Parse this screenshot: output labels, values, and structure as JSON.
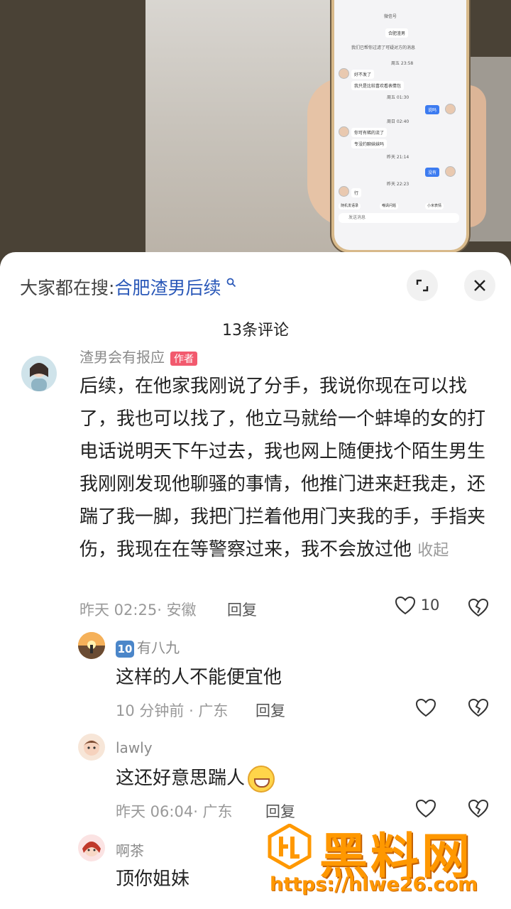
{
  "video": {
    "phone_chat": {
      "title": "微信号",
      "label_chip": "合肥渣男",
      "notice": "我们已帮你过滤了可疑对方的消息",
      "time1": "周五 23:58",
      "msg1": "好不发了",
      "msg2": "我只是比较喜欢看表情包",
      "time2": "周五 01:30",
      "my_msg1": "说吗",
      "time3": "周日 02:40",
      "msg3": "你可有稀的流了",
      "msg4": "专没约聊妹妹吗",
      "time4": "昨天 21:14",
      "my_msg2": "没有",
      "time5": "昨天 22:23",
      "msg5": "行",
      "chips": [
        "随机发语录",
        "嘲讽问题",
        "小米表情"
      ],
      "input_placeholder": "发送消息"
    }
  },
  "search": {
    "prefix": "大家都在搜:",
    "keyword": "合肥渣男后续",
    "icon": "search-icon"
  },
  "comments_count": "13条评论",
  "comments": [
    {
      "author": "渣男会有报应",
      "author_tag": "作者",
      "text": "后续，在他家我刚说了分手，我说你现在可以找了，我也可以找了，他立马就给一个蚌埠的女的打电话说明天下午过去，我也网上随便找个陌生男生我刚刚发现他聊骚的事情，他推门进来赶我走，还踹了我一脚，我把门拦着他用门夹我的手，手指夹伤，我现在在等警察过来，我不会放过他",
      "collapse": "收起",
      "meta": "昨天 02:25· 安徽",
      "reply": "回复",
      "likes": "10"
    }
  ],
  "replies": [
    {
      "badge": "10",
      "author": "有八九",
      "text": "这样的人不能便宜他",
      "meta": "10 分钟前 · 广东",
      "reply": "回复"
    },
    {
      "author": "lawly",
      "text": "这还好意思踹人",
      "meta": "昨天 06:04· 广东",
      "reply": "回复"
    },
    {
      "author": "啊茶",
      "text": "顶你姐妹"
    }
  ],
  "watermark": {
    "title": "黑料网",
    "url": "https://hlwe26.com"
  },
  "colors": {
    "keyword_blue": "#2a58b8",
    "watermark_orange": "#ff9800"
  }
}
